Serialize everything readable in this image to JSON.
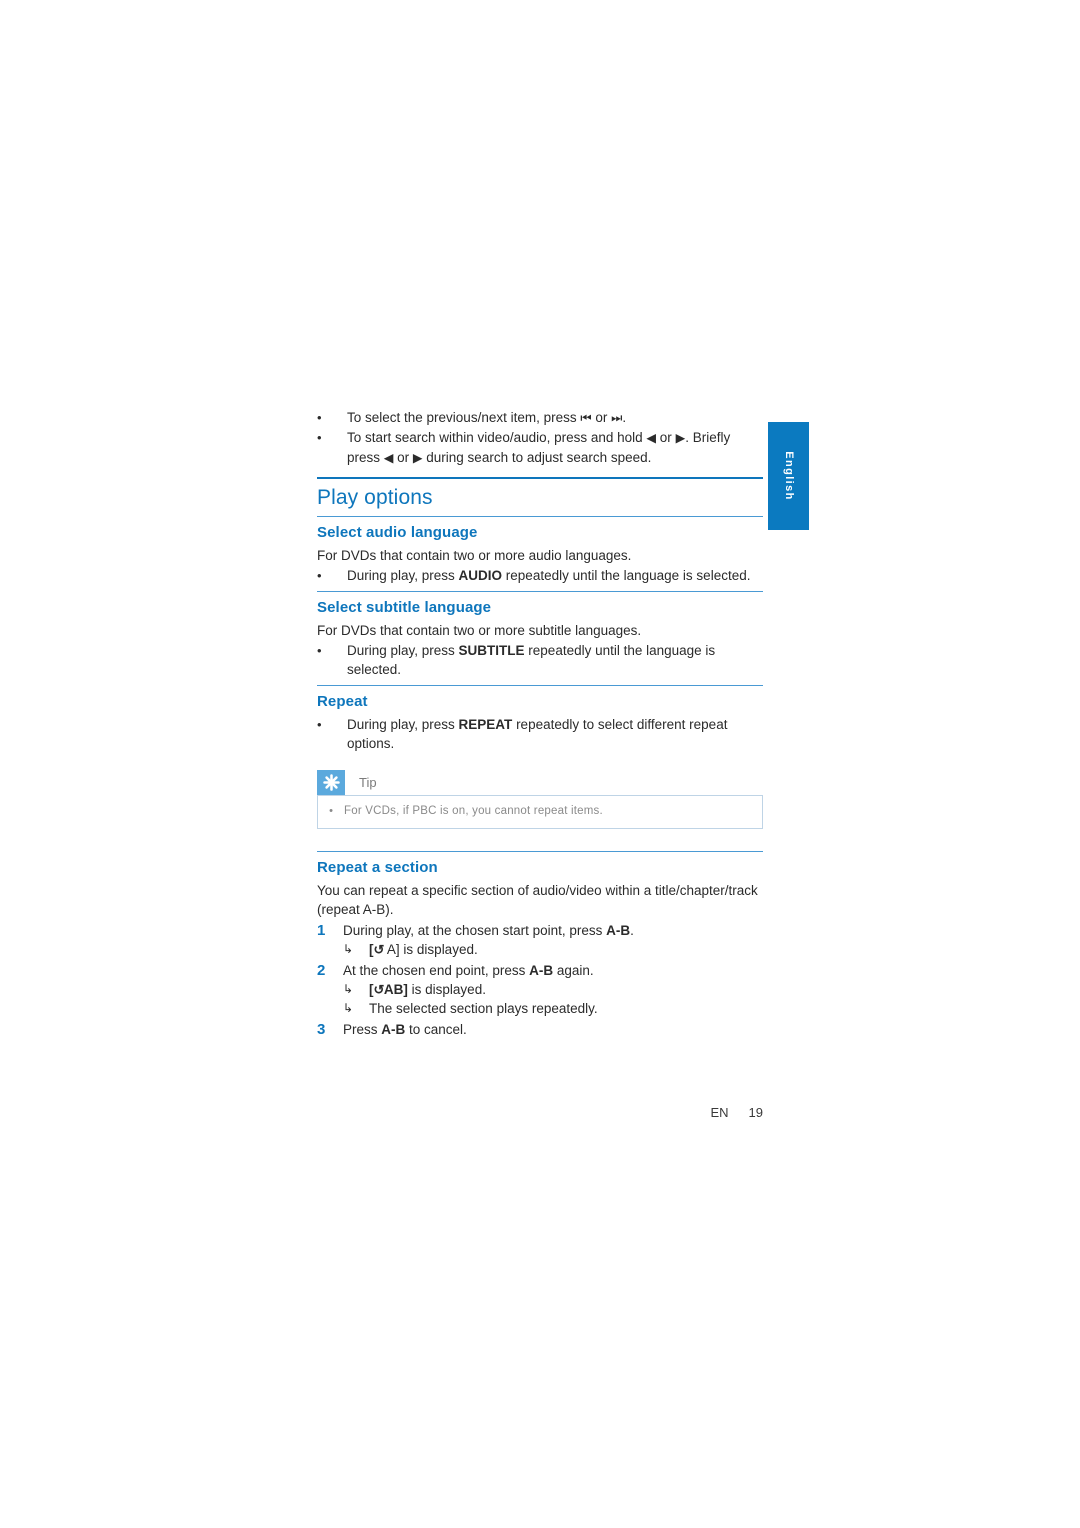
{
  "page": {
    "language_tab": "English",
    "footer_locale": "EN",
    "footer_page_number": "19",
    "accent_color": "#0e76bc",
    "tab_color": "#0b7ac0",
    "tip_icon_color": "#5ba9dd"
  },
  "intro_bullets": [
    {
      "text_before": "To select the previous/next item, press ",
      "glyph1": "⏮",
      "text_mid": " or ",
      "glyph2": "⏭",
      "text_after": "."
    },
    {
      "text_before": "To start search within video/audio, press and hold ",
      "glyph1": "◀",
      "text_mid": " or ",
      "glyph2": "▶",
      "text_after": ". Briefly press ",
      "glyph3": "◀",
      "text_mid2": " or ",
      "glyph4": "▶",
      "text_end": " during search to adjust search speed."
    }
  ],
  "section": {
    "title": "Play options"
  },
  "select_audio_language": {
    "heading": "Select audio language",
    "intro": "For DVDs that contain two or more audio languages.",
    "bullet_before": "During play, press ",
    "bullet_key": "AUDIO",
    "bullet_after": " repeatedly until the language is selected."
  },
  "select_subtitle_language": {
    "heading": "Select subtitle language",
    "intro": "For DVDs that contain two or more subtitle languages.",
    "bullet_before": "During play, press ",
    "bullet_key": "SUBTITLE",
    "bullet_after": " repeatedly until the language is selected."
  },
  "repeat": {
    "heading": "Repeat",
    "bullet_before": "During play, press ",
    "bullet_key": "REPEAT",
    "bullet_after": " repeatedly to select different repeat options.",
    "tip": {
      "icon": "asterisk-icon",
      "label": "Tip",
      "bullet": "For VCDs, if PBC is on, you cannot repeat items."
    }
  },
  "repeat_a_section": {
    "heading": "Repeat a section",
    "intro": "You can repeat a specific section of audio/video within a title/chapter/track (repeat A-B).",
    "steps": [
      {
        "number": "1",
        "text_before": "During play, at the chosen start point, press ",
        "key": "A-B",
        "text_after": ".",
        "results": [
          {
            "arrow": "↳",
            "prefix": "[",
            "glyph": "↺",
            "label": " A]",
            "suffix": " is displayed."
          }
        ]
      },
      {
        "number": "2",
        "text_before": "At the chosen end point, press ",
        "key": "A-B",
        "text_after": " again.",
        "results": [
          {
            "arrow": "↳",
            "prefix": "[",
            "glyph": "↺",
            "label": "AB]",
            "suffix": " is displayed."
          },
          {
            "arrow": "↳",
            "prefix": "",
            "glyph": "",
            "label": "",
            "suffix": "The selected section plays repeatedly."
          }
        ]
      },
      {
        "number": "3",
        "text_before": "Press ",
        "key": "A-B",
        "text_after": " to cancel.",
        "results": []
      }
    ]
  }
}
